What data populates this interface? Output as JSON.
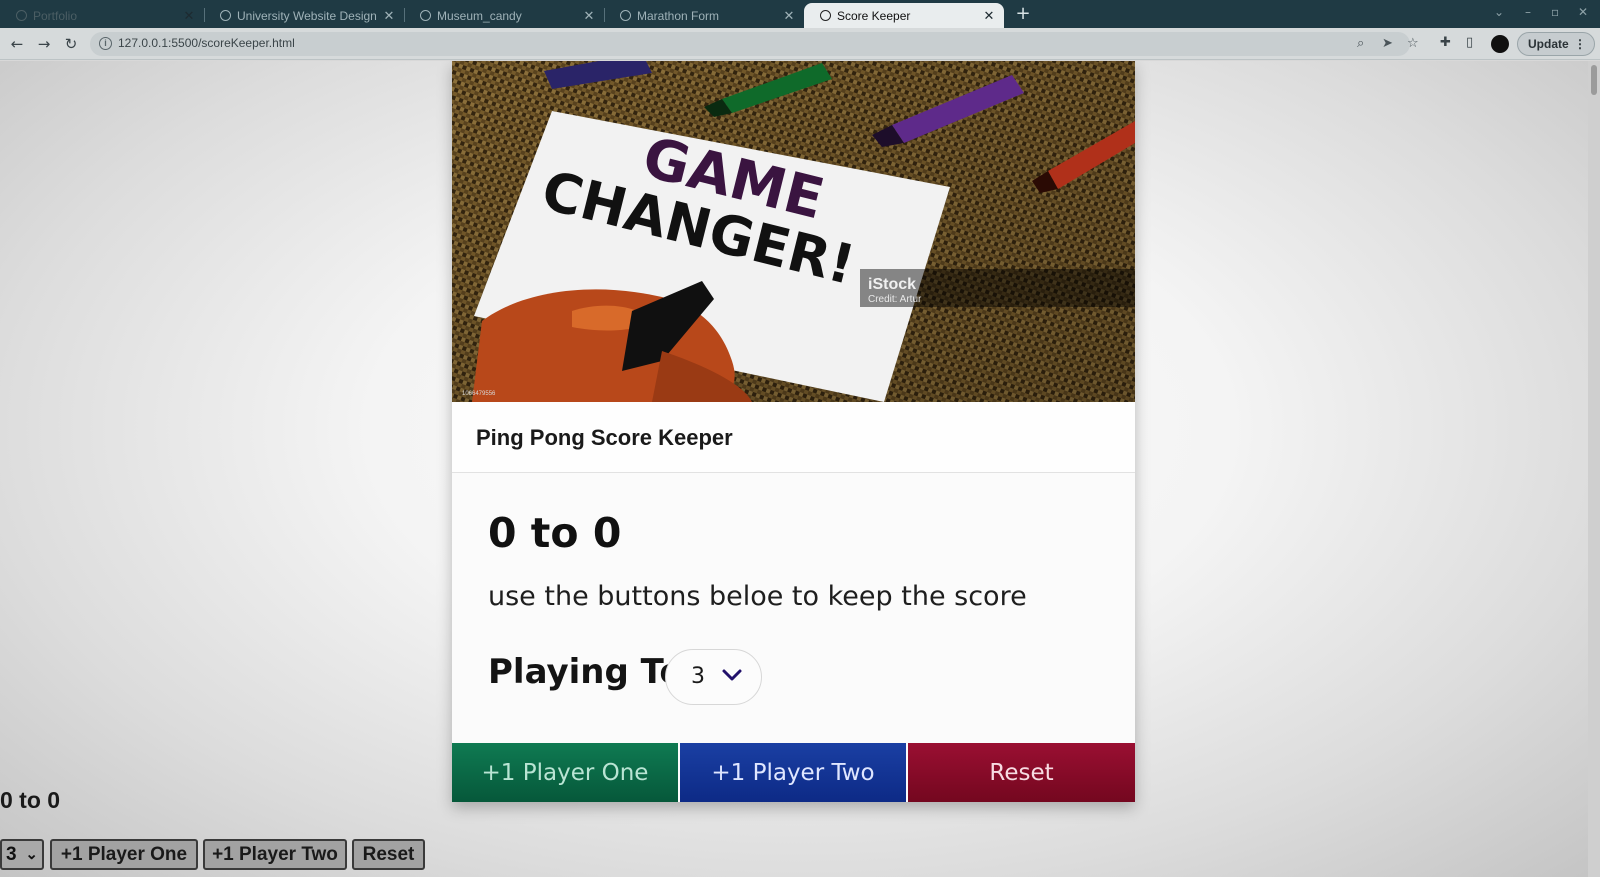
{
  "browser": {
    "tabs": [
      {
        "title": "Portfolio"
      },
      {
        "title": "University Website Design"
      },
      {
        "title": "Museum_candy"
      },
      {
        "title": "Marathon Form"
      },
      {
        "title": "Score Keeper"
      }
    ],
    "new_tab": "+",
    "url": "127.0.0.1:5500/scoreKeeper.html",
    "update_label": "Update"
  },
  "card": {
    "hero_image": {
      "alt": "Game changer note with markers",
      "sign_text_1": "GAME",
      "sign_text_2": "CHANGER!",
      "watermark_1": "iStock",
      "watermark_2": "Credit: Artur",
      "watermark_id": "1066479556"
    },
    "title": "Ping Pong Score Keeper",
    "score_display": "0 to 0",
    "instructions": "use the buttons beloe to keep the score",
    "playing_to_label": "Playing To",
    "playing_to_value": "3",
    "buttons": {
      "player_one": "+1 Player One",
      "player_two": "+1 Player Two",
      "reset": "Reset"
    },
    "colors": {
      "player_one": "#0b6b46",
      "player_two": "#143596",
      "reset": "#880c29"
    }
  },
  "fallback": {
    "score_display": "0 to 0",
    "select_value": "3",
    "player_one": "+1 Player One",
    "player_two": "+1 Player Two",
    "reset": "Reset"
  }
}
